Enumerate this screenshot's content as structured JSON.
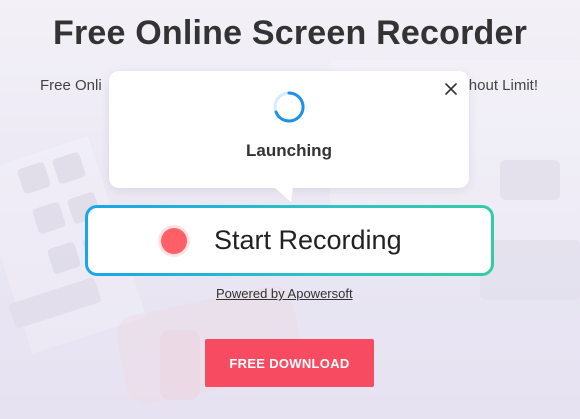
{
  "header": {
    "title": "Free Online Screen Recorder",
    "subtitle_left": "Free Onli",
    "subtitle_right": "hout Limit!"
  },
  "popup": {
    "status": "Launching",
    "close_icon": "close-icon",
    "spinner_icon": "loading-spinner-icon"
  },
  "recorder": {
    "start_label": "Start Recording",
    "record_icon": "record-dot-icon"
  },
  "powered_by": "Powered by Apowersoft",
  "download": {
    "label": "FREE DOWNLOAD"
  },
  "colors": {
    "download_button": "#f74b61",
    "record_dot": "#ff5f66",
    "border_gradient_start": "#18a6ea",
    "border_gradient_end": "#33cba5",
    "spinner": "#1e90e6"
  }
}
